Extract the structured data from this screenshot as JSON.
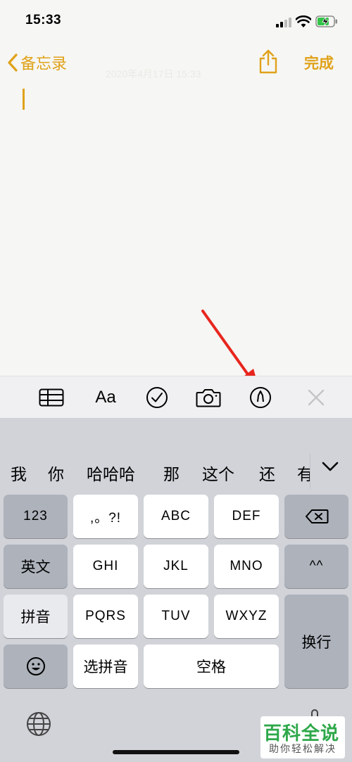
{
  "status_bar": {
    "time": "15:33"
  },
  "nav": {
    "back_label": "备忘录",
    "done_label": "完成"
  },
  "note": {
    "date_watermark": "2020年4月17日 15:33"
  },
  "toolbar": {
    "format_label": "Aa"
  },
  "keyboard": {
    "candidates": [
      "我",
      "你",
      "哈哈哈",
      "那",
      "这个",
      "还",
      "有"
    ],
    "row1": [
      "123",
      ",。?!",
      "ABC",
      "DEF"
    ],
    "row2": [
      "英文",
      "GHI",
      "JKL",
      "MNO",
      "^^"
    ],
    "row3": [
      "拼音",
      "PQRS",
      "TUV",
      "WXYZ",
      "换行"
    ],
    "row4": [
      "选拼音",
      "空格"
    ]
  },
  "watermark": {
    "title": "百科全说",
    "subtitle": "助你轻松解决"
  },
  "colors": {
    "accent": "#e0a21a",
    "key_gray": "#adb2bb",
    "keyboard_bg": "#d1d3d9",
    "watermark_green": "#2ea84a"
  }
}
